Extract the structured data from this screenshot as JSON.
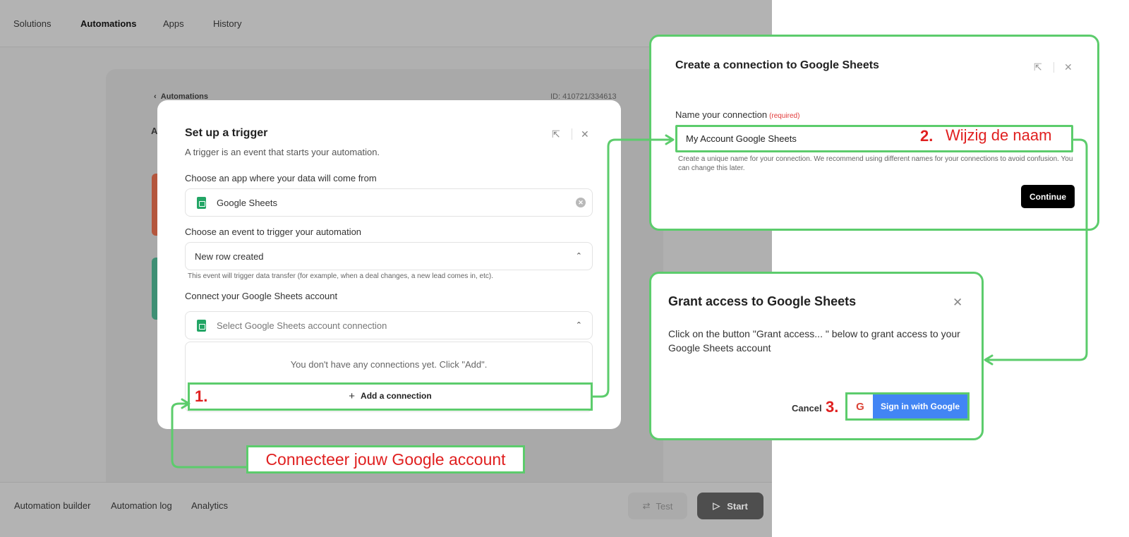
{
  "nav": {
    "items": [
      "Solutions",
      "Automations",
      "Apps",
      "History"
    ],
    "active": "Automations"
  },
  "background": {
    "back_label": "Automations",
    "id_label": "ID: 410721/334613",
    "heading_initial": "A"
  },
  "bottom_bar": {
    "tabs": [
      "Automation builder",
      "Automation log",
      "Analytics"
    ],
    "test_label": "Test",
    "start_label": "Start"
  },
  "trigger_modal": {
    "title": "Set up a trigger",
    "subtitle": "A trigger is an event that starts your automation.",
    "app_label": "Choose an app where your data will come from",
    "app_value": "Google Sheets",
    "event_label": "Choose an event to trigger your automation",
    "event_value": "New row created",
    "event_hint": "This event will trigger data transfer (for example, when a deal changes, a new lead comes in, etc).",
    "account_label": "Connect your Google Sheets account",
    "account_placeholder": "Select Google Sheets account connection",
    "empty_text": "You don't have any connections yet. Click \"Add\".",
    "add_connection_label": "Add a connection"
  },
  "connection_modal": {
    "title": "Create a connection to Google Sheets",
    "name_label": "Name your connection",
    "required_label": "(required)",
    "name_value": "My Account Google Sheets",
    "help_text": "Create a unique name for your connection. We recommend using different names for your connections to avoid confusion. You can change this later.",
    "continue_label": "Continue"
  },
  "grant_modal": {
    "title": "Grant access to Google Sheets",
    "body": "Click on the button \"Grant access... \" below to grant access to your Google Sheets account",
    "cancel_label": "Cancel",
    "google_logo": "G",
    "google_label": "Sign in with Google"
  },
  "annotations": {
    "step1": "1.",
    "step2": "2.",
    "step2_text": "Wijzig de naam",
    "step3": "3.",
    "connect_text": "Connecteer jouw Google account"
  },
  "colors": {
    "annotation_green": "#5ccc6c",
    "annotation_red": "#e02020",
    "google_blue": "#4285f4",
    "sheets_green": "#22a565"
  }
}
